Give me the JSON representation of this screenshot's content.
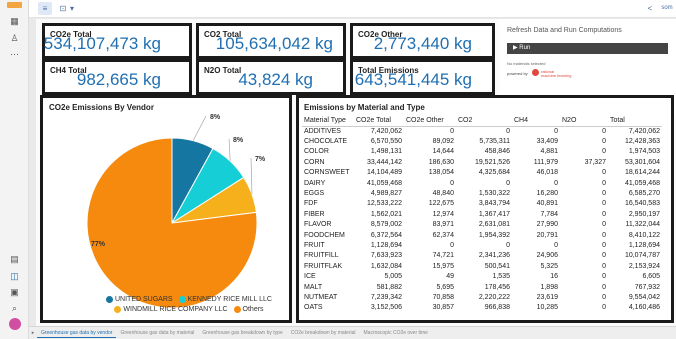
{
  "toolbar": {
    "left_icon": "≡",
    "split_icon": "⊡",
    "dropdown": "▾",
    "share_icon": "<",
    "right_text": "som"
  },
  "cards": {
    "co2e_total": {
      "label": "CO2e Total",
      "value": "534,107,473 kg"
    },
    "co2_total": {
      "label": "CO2 Total",
      "value": "105,634,042 kg"
    },
    "co2e_other": {
      "label": "CO2e Other",
      "value": "2,773,440 kg"
    },
    "ch4_total": {
      "label": "CH4 Total",
      "value": "982,665 kg"
    },
    "n2o_total": {
      "label": "N2O Total",
      "value": "43,824 kg"
    },
    "total_emissions": {
      "label": "Total Emissions",
      "value": "643,541,445 kg"
    }
  },
  "refresh": {
    "title": "Refresh Data and Run Computations",
    "run_label": "▶ Run",
    "note": "No materials selected",
    "powered": "powered by",
    "brand_line1": "rational",
    "brand_line2": "machine learning"
  },
  "chart_data": {
    "type": "pie",
    "title": "CO2e Emissions By Vendor",
    "slices": [
      {
        "name": "UNITED SUGARS",
        "value": 8,
        "label": "8%",
        "color": "#1577a1"
      },
      {
        "name": "KENNEDY RICE MILL LLC",
        "value": 8,
        "label": "8%",
        "color": "#16cfd6"
      },
      {
        "name": "WINDMILL RICE COMPANY LLC",
        "value": 7,
        "label": "7%",
        "color": "#f6b01c"
      },
      {
        "name": "Others",
        "value": 77,
        "label": "77%",
        "color": "#f58a0f"
      }
    ]
  },
  "table": {
    "title": "Emissions by Material and Type",
    "headers": [
      "Material Type",
      "CO2e Total",
      "CO2e Other",
      "CO2",
      "CH4",
      "N2O",
      "Total"
    ],
    "rows": [
      [
        "ADDITIVES",
        "7,420,062",
        "0",
        "0",
        "0",
        "0",
        "7,420,062"
      ],
      [
        "CHOCOLATE",
        "6,570,550",
        "89,092",
        "5,735,311",
        "33,409",
        "0",
        "12,428,363"
      ],
      [
        "COLOR",
        "1,498,131",
        "14,644",
        "458,846",
        "4,881",
        "0",
        "1,974,503"
      ],
      [
        "CORN",
        "33,444,142",
        "186,630",
        "19,521,526",
        "111,979",
        "37,327",
        "53,301,604"
      ],
      [
        "CORNSWEET",
        "14,104,489",
        "138,054",
        "4,325,684",
        "46,018",
        "0",
        "18,614,244"
      ],
      [
        "DAIRY",
        "41,059,468",
        "0",
        "0",
        "0",
        "0",
        "41,059,468"
      ],
      [
        "EGGS",
        "4,989,827",
        "48,840",
        "1,530,322",
        "16,280",
        "0",
        "6,585,270"
      ],
      [
        "FDF",
        "12,533,222",
        "122,675",
        "3,843,794",
        "40,891",
        "0",
        "16,540,583"
      ],
      [
        "FIBER",
        "1,562,021",
        "12,974",
        "1,367,417",
        "7,784",
        "0",
        "2,950,197"
      ],
      [
        "FLAVOR",
        "8,579,002",
        "83,971",
        "2,631,081",
        "27,990",
        "0",
        "11,322,044"
      ],
      [
        "FOODCHEM",
        "6,372,564",
        "62,374",
        "1,954,392",
        "20,791",
        "0",
        "8,410,122"
      ],
      [
        "FRUIT",
        "1,128,694",
        "0",
        "0",
        "0",
        "0",
        "1,128,694"
      ],
      [
        "FRUITFILL",
        "7,633,923",
        "74,721",
        "2,341,236",
        "24,906",
        "0",
        "10,074,787"
      ],
      [
        "FRUITFLAK",
        "1,632,084",
        "15,975",
        "500,541",
        "5,325",
        "0",
        "2,153,924"
      ],
      [
        "ICE",
        "5,005",
        "49",
        "1,535",
        "16",
        "0",
        "6,605"
      ],
      [
        "MALT",
        "581,882",
        "5,695",
        "178,456",
        "1,898",
        "0",
        "767,932"
      ],
      [
        "NUTMEAT",
        "7,239,342",
        "70,858",
        "2,220,222",
        "23,619",
        "0",
        "9,554,042"
      ],
      [
        "OATS",
        "3,152,506",
        "30,857",
        "966,838",
        "10,285",
        "0",
        "4,160,486"
      ]
    ]
  },
  "bottom_tabs": [
    "Greenhouse gas data by vendor",
    "Greenhouse gas data by material",
    "Greenhouse gas breakdown by type",
    "CO2e breakdown by material",
    "Macroscopic CO2e over time"
  ]
}
